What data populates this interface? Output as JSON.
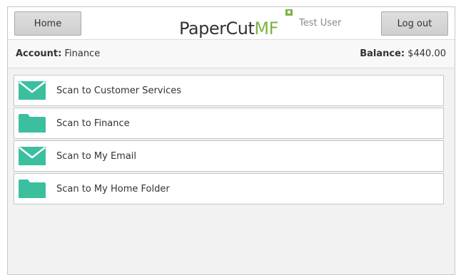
{
  "header": {
    "home_label": "Home",
    "logout_label": "Log out",
    "logo_text": "PaperCut",
    "logo_suffix": "MF",
    "username": "Test User"
  },
  "account_bar": {
    "account_label": "Account:",
    "account_value": "Finance",
    "balance_label": "Balance:",
    "balance_value": "$440.00"
  },
  "scan_actions": [
    {
      "label": "Scan to Customer Services",
      "icon": "envelope-icon"
    },
    {
      "label": "Scan to Finance",
      "icon": "folder-icon"
    },
    {
      "label": "Scan to My Email",
      "icon": "envelope-icon"
    },
    {
      "label": "Scan to My Home Folder",
      "icon": "folder-icon"
    }
  ],
  "colors": {
    "accent": "#3bbf9f",
    "brand_green": "#7cb342"
  }
}
